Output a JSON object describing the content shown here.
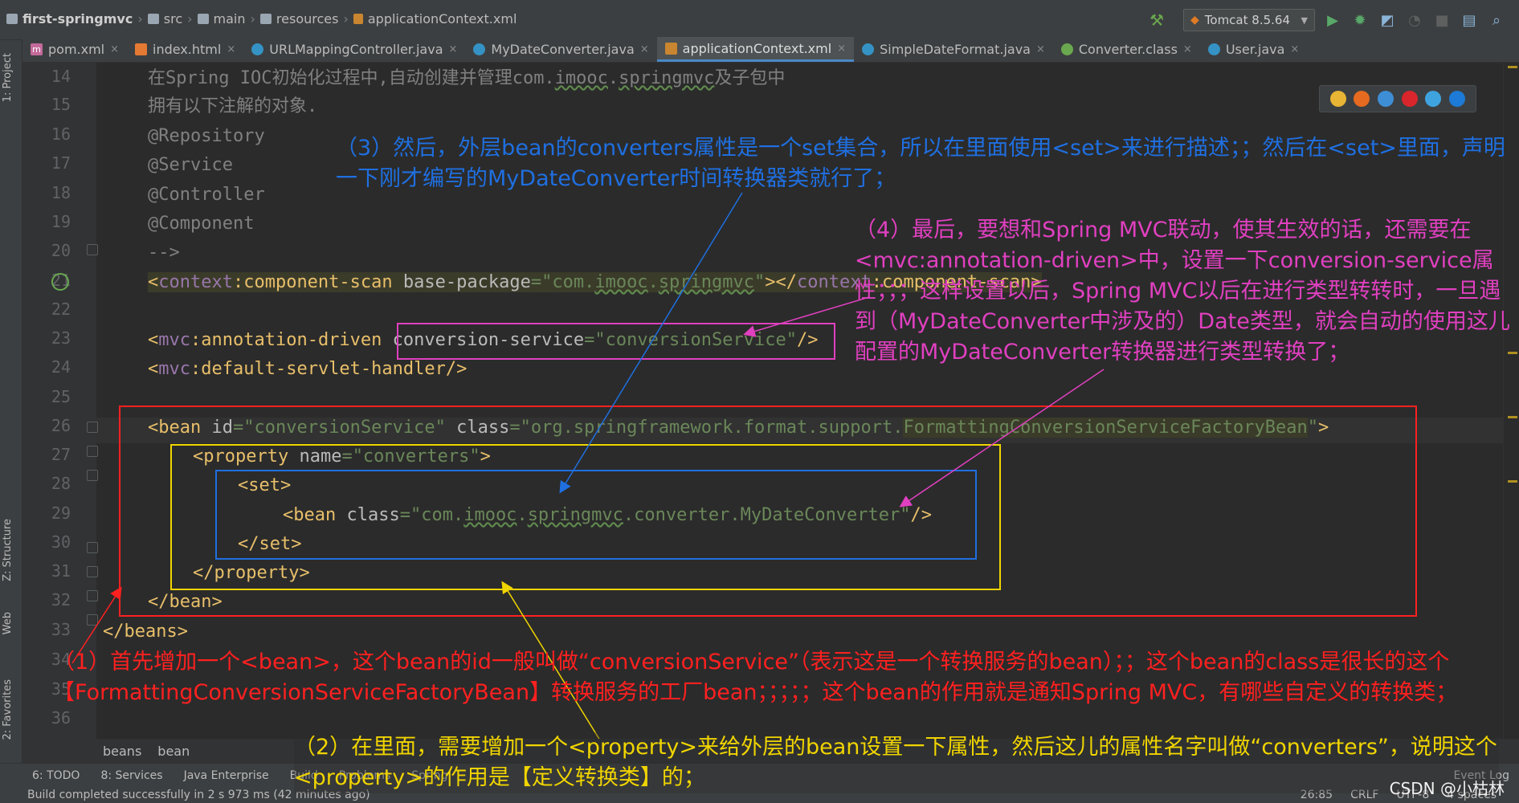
{
  "breadcrumb": [
    "first-springmvc",
    "src",
    "main",
    "resources",
    "applicationContext.xml"
  ],
  "run_config": "Tomcat 8.5.64",
  "tabs": [
    "pom.xml",
    "index.html",
    "URLMappingController.java",
    "MyDateConverter.java",
    "applicationContext.xml",
    "SimpleDateFormat.java",
    "Converter.class",
    "User.java"
  ],
  "active_tab": "applicationContext.xml",
  "side_tabs": [
    "1: Project",
    "Z: Structure",
    "Web",
    "2: Favorites"
  ],
  "line_numbers": [
    "14",
    "15",
    "16",
    "17",
    "18",
    "19",
    "20",
    "21",
    "22",
    "23",
    "24",
    "25",
    "26",
    "27",
    "28",
    "29",
    "30",
    "31",
    "32",
    "33",
    "34",
    "35",
    "36"
  ],
  "code": {
    "l14": "在Spring IOC初始化过程中,自动创建并管理com.",
    "l14b": "imooc",
    "l14c": ".",
    "l14d": "springmvc",
    "l14e": "及子包中",
    "l15": "拥有以下注解的对象.",
    "l16": "@Repository",
    "l17": "@Service",
    "l18": "@Controller",
    "l19": "@Component",
    "l20": "-->",
    "l21_open": "<",
    "l21_ns": "context",
    "l21_tag": ":component-scan ",
    "l21_attr": "base-package",
    "l21_eq": "=",
    "l21_val_a": "\"com.",
    "l21_val_b": "imooc",
    "l21_val_c": ".",
    "l21_val_d": "springmvc",
    "l21_val_e": "\"",
    "l21_close": "></",
    "l21_ns2": "context",
    "l21_tag2": ":component-scan>",
    "l23_a": "<",
    "l23_ns": "mvc",
    "l23_tag": ":annotation-driven ",
    "l23_attr": "conversion-service",
    "l23_eq": "=",
    "l23_val": "\"conversionService\"",
    "l23_end": "/>",
    "l24_a": "<",
    "l24_ns": "mvc",
    "l24_tag": ":default-servlet-handler/>",
    "l26_a": "<bean ",
    "l26_attr1": "id",
    "l26_eq1": "=",
    "l26_val1": "\"conversionService\" ",
    "l26_attr2": "class",
    "l26_eq2": "=",
    "l26_val2": "\"org.springframework.format.support.",
    "l26_val2b": "FormattingConversionServiceFactoryBean",
    "l26_val2c": "\"",
    "l26_end": ">",
    "l27_a": "<property ",
    "l27_attr": "name",
    "l27_eq": "=",
    "l27_val": "\"converters\"",
    "l27_end": ">",
    "l28": "<set>",
    "l29_a": "<bean ",
    "l29_attr": "class",
    "l29_eq": "=",
    "l29_val_a": "\"com.",
    "l29_val_b": "imooc",
    "l29_val_c": ".",
    "l29_val_d": "springmvc",
    "l29_val_e": ".converter.MyDateConverter\"",
    "l29_end": "/>",
    "l30": "</set>",
    "l31": "</property>",
    "l32": "</bean>",
    "l33": "</beans>"
  },
  "annotations": {
    "a1": "（1）首先增加一个<bean>，这个bean的id一般叫做“conversionService”（表示这是一个转换服务的bean）；；这个bean的class是很长的这个【FormattingConversionServiceFactoryBean】转换服务的工厂bean；；；；；这个bean的作用就是通知Spring MVC，有哪些自定义的转换类；",
    "a2": "（2）在里面，需要增加一个<property>来给外层的bean设置一下属性，然后这儿的属性名字叫做“converters”，说明这个<property>的作用是【定义转换类】的；",
    "a3": "（3）然后，外层bean的converters属性是一个set集合，所以在里面使用<set>来进行描述；；然后在<set>里面，声明一下刚才编写的MyDateConverter时间转换器类就行了；",
    "a4": "（4）最后，要想和Spring MVC联动，使其生效的话，还需要在<mvc:annotation-driven>中，设置一下conversion-service属性；；；这样设置以后，Spring MVC以后在进行类型转转时，一旦遇到（MyDateConverter中涉及的）Date类型，就会自动的使用这儿配置的MyDateConverter转换器进行类型转换了；"
  },
  "editor_breadcrumb": [
    "beans",
    "bean"
  ],
  "bottom_tools": [
    "6: TODO",
    "8: Services",
    "Java Enterprise",
    "Build",
    "Problems",
    "Spring",
    "Event Log"
  ],
  "status": {
    "message": "Build completed successfully in 2 s 973 ms (42 minutes ago)",
    "position": "26:85",
    "line_sep": "CRLF",
    "encoding": "UTF-8",
    "indent": "4 spaces"
  },
  "watermark": "CSDN @小枯林",
  "colors": {
    "red_box": "#ff2020",
    "yellow_box": "#f0d400",
    "blue_box": "#1f6fe0",
    "pink_box": "#e040c0"
  }
}
